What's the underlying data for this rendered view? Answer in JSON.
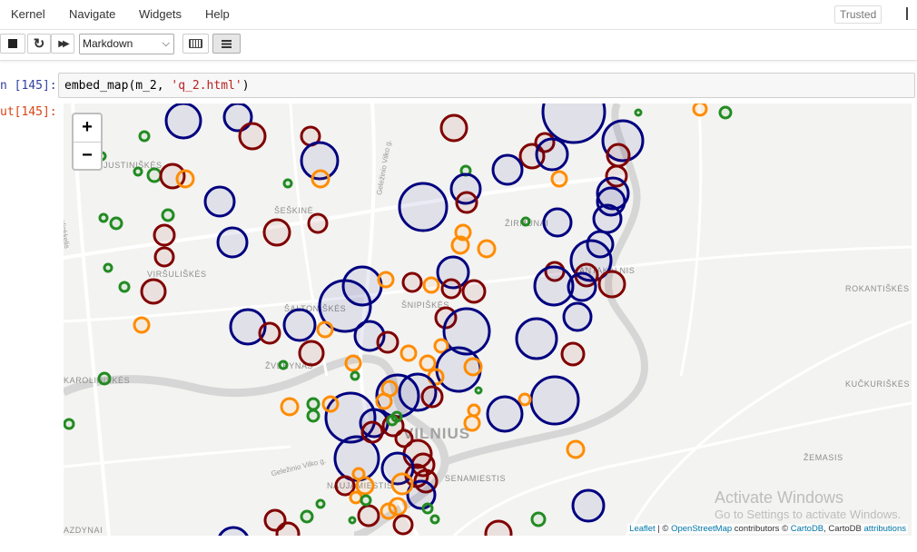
{
  "menu": {
    "kernel": "Kernel",
    "navigate": "Navigate",
    "widgets": "Widgets",
    "help": "Help",
    "trusted": "Trusted"
  },
  "toolbar": {
    "cell_type": "Markdown",
    "icons": [
      "stop-icon",
      "restart-icon",
      "fast-forward-icon",
      "keyboard-icon",
      "command-palette-icon"
    ]
  },
  "cell_in": {
    "prompt": "n [145]:",
    "code_pre": "embed_map(m_2, ",
    "code_str": "'q_2.html'",
    "code_post": ")"
  },
  "cell_out": {
    "prompt": "ut[145]:"
  },
  "map": {
    "zoom_in": "+",
    "zoom_out": "−",
    "places": {
      "justiniskes": "JUSTINIŠKĖS",
      "seskine": "ŠEŠKINĖ",
      "zirmunai": "ŽIRMŪNAI",
      "virsuliskes": "VIRŠULIŠKĖS",
      "saltoniskes": "ŠALTONIŠKĖS",
      "snipiskes": "ŠNIPIŠKĖS",
      "antakalnis": "ANTAKALNIS",
      "rokantiskes": "ROKANTIŠKĖS",
      "karoliniskes": "KAROLINIŠKĖS",
      "zverynas": "ŽVĖRYNAS",
      "kucukiskes": "KUČKURIŠKĖS",
      "vilnius": "VILNIUS",
      "zemasis": "ŽEMASIS",
      "senamiestis": "SENAMIESTIS",
      "naujamiestis": "NAUJAMIESTIS",
      "lazdynai": "AZDYNAI"
    },
    "road_labels": {
      "vakarinis": "Vakarinis aplinkkelis",
      "gelezinio1": "Geležinio Vilko g.",
      "gelezinio2": "Geležinio Vilko g."
    },
    "attribution": {
      "leaflet": "Leaflet",
      "sep": " | © ",
      "osm": "OpenStreetMap",
      "mid": " contributors © ",
      "carto": "CartoDB",
      "mid2": ", CartoDB ",
      "attr": "attributions"
    },
    "colors": {
      "navy": "#000080",
      "darkred": "#800000",
      "orange": "#ff8c00",
      "green": "#228b22"
    }
  },
  "watermark": {
    "title": "Activate Windows",
    "subtitle": "Go to Settings to activate Windows."
  }
}
